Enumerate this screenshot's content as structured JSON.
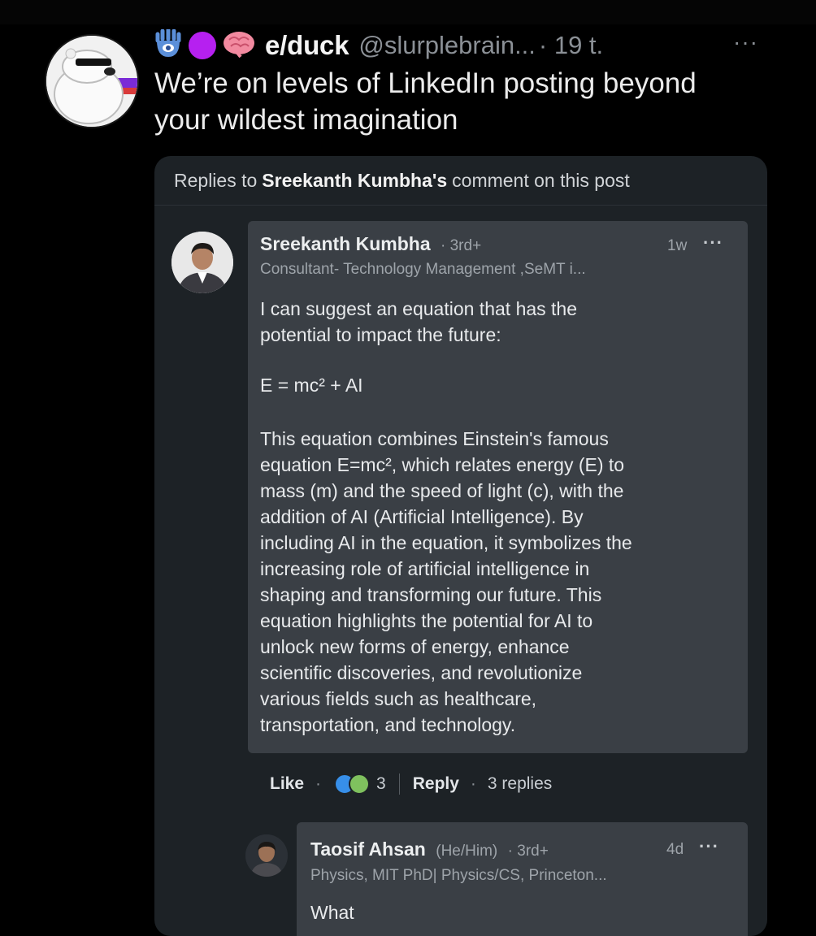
{
  "tweet": {
    "display_name": "e/duck",
    "handle": "@slurplebrain...",
    "time": "· 19 t.",
    "more": "···",
    "text_line1": "We’re on levels of LinkedIn posting beyond",
    "text_line2": "your wildest imagination",
    "badges": [
      "hamsa-icon",
      "purple-circle-icon",
      "brain-icon"
    ]
  },
  "card": {
    "header_prefix": "Replies to",
    "header_name": "Sreekanth Kumbha's",
    "header_mid": "comment on this post",
    "header_post": ""
  },
  "comment": {
    "author": "Sreekanth Kumbha",
    "degree": "· 3rd+",
    "time": "1w",
    "more": "···",
    "headline": "Consultant- Technology Management ,SeMT i...",
    "lines": [
      "I can suggest an equation that has the",
      "potential to impact the future:",
      "E = mc² + AI",
      "This equation combines Einstein's famous",
      "equation E=mc², which relates energy (E) to",
      "mass (m) and the speed of light (c), with the",
      "addition of AI (Artificial Intelligence). By",
      "including AI in the equation, it symbolizes the",
      "increasing role of artificial intelligence in",
      "shaping and transforming our future. This",
      "equation highlights the potential for AI to",
      "unlock new forms of energy, enhance",
      "scientific discoveries, and revolutionize",
      "various fields such as healthcare,",
      "transportation, and technology."
    ]
  },
  "actions": {
    "like": "Like",
    "dot": "·",
    "reaction_count": "3",
    "reply": "Reply",
    "replies": "3 replies"
  },
  "reply": {
    "author": "Taosif Ahsan",
    "pronouns": "(He/Him)",
    "degree": "· 3rd+",
    "time": "4d",
    "more": "···",
    "headline": "Physics, MIT PhD| Physics/CS, Princeton...",
    "text": "What"
  },
  "colors": {
    "background": "#000000",
    "card": "#1d2226",
    "bubble": "#3a3f45",
    "accent_purple": "#b620f0",
    "reaction_blue": "#378fe9"
  }
}
